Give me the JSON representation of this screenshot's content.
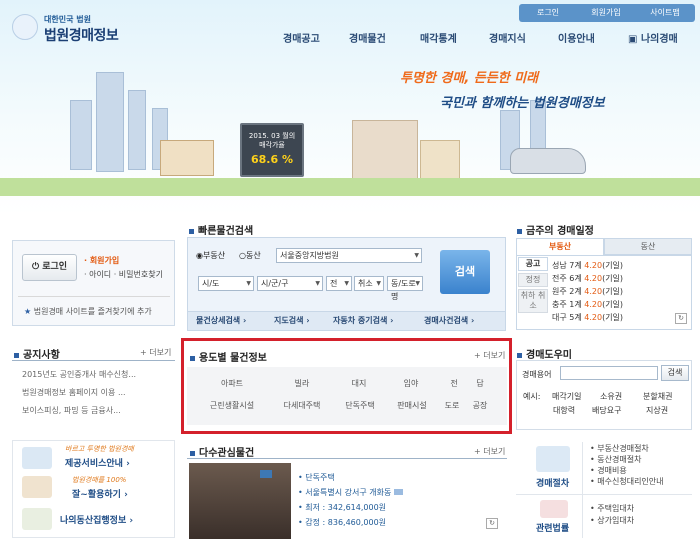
{
  "header": {
    "toplinks": [
      "로그인",
      "회원가입",
      "사이트맵"
    ],
    "logo_sub": "대한민국 법원",
    "logo_main": "법원경매정보",
    "nav": [
      "경매공고",
      "경매물건",
      "매각통계",
      "경매지식",
      "이용안내",
      "나의경매"
    ],
    "slogan1": "투명한 경매, 든든한 미래",
    "slogan2": "국민과 함께하는 법원경매정보",
    "board_line1": "2015. 03 월의",
    "board_line2": "매각가율",
    "board_rate": "68.6 %"
  },
  "login": {
    "button": "로그인",
    "join": "· 회원가입",
    "find": "· 아이디 · 비밀번호찾기",
    "favorite": "법원경매 사이트를 즐겨찾기에 추가"
  },
  "notice": {
    "title": "공지사항",
    "more": "+ 더보기",
    "items": [
      "2015년도 공인중개사 매수신청...",
      "법원경매정보 홈페이지 이용 ...",
      "보이스피싱, 파밍 등 금융사..."
    ]
  },
  "left_banners": {
    "b1_small": "바르고 투명한 법원경매",
    "b1_main": "제공서비스안내",
    "b2_small": "법원경매를 100%",
    "b2_main": "잘~활용하기",
    "b3_main": "나의동산집행정보"
  },
  "quick_search": {
    "title": "빠른물건검색",
    "radio1": "부동산",
    "radio2": "동산",
    "court": "서울중앙지방법원",
    "sido": "시/도",
    "sigungu": "시/군/구",
    "jeon": "전",
    "cancel": "취소",
    "dong": "동/도로명",
    "search": "검색",
    "tabs": [
      "물건상세검색",
      "지도검색",
      "자동차 중기검색",
      "경매사건검색"
    ]
  },
  "usage_search": {
    "title": "용도별 물건정보",
    "more": "+ 더보기",
    "row1": [
      "아파트",
      "빌라",
      "대지",
      "임야",
      "전",
      "답"
    ],
    "row2": [
      "근린생활시설",
      "다세대주택",
      "단독주택",
      "판매시설",
      "도로",
      "공장"
    ]
  },
  "popular": {
    "title": "다수관심물건",
    "more": "+ 더보기",
    "type": "단독주택",
    "address": "서울특별시 강서구 개화동",
    "min_price": "최저 : 342,614,000원",
    "appraisal": "감정 : 836,460,000원"
  },
  "schedule": {
    "title": "금주의 경매일정",
    "tab1": "부동산",
    "tab2": "동산",
    "side": [
      "공고",
      "정정",
      "취하 취소"
    ],
    "items": [
      {
        "court": "성남 7계",
        "date": "4.20",
        "day": "(기일)"
      },
      {
        "court": "전주 6계",
        "date": "4.20",
        "day": "(기일)"
      },
      {
        "court": "원주 2계",
        "date": "4.20",
        "day": "(기일)"
      },
      {
        "court": "충주 1계",
        "date": "4.20",
        "day": "(기일)"
      },
      {
        "court": "대구 5계",
        "date": "4.20",
        "day": "(기일)"
      }
    ]
  },
  "glossary": {
    "title": "경매도우미",
    "label": "경매용어",
    "search": "검색",
    "example_label": "예시:",
    "examples": [
      "매각기일",
      "소유권",
      "분할채권",
      "대항력",
      "배당요구",
      "지상권"
    ]
  },
  "procedure": {
    "b1": "경매절차",
    "b2": "관련법률",
    "list1": [
      "부동산경매절차",
      "동산경매절차",
      "경매비용",
      "매수신청대리인안내"
    ],
    "list2": [
      "주택임대차",
      "상가임대차"
    ]
  },
  "colors": {
    "accent": "#2d5fa3",
    "highlight": "#d4202b",
    "orange": "#ef6a1a"
  }
}
